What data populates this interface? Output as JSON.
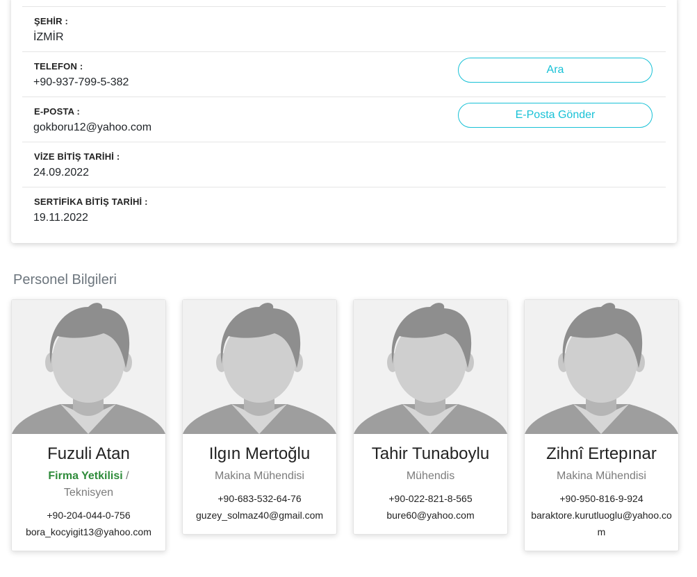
{
  "contact_info": {
    "rows": [
      {
        "label": "ŞEHİR :",
        "value": "İZMİR"
      },
      {
        "label": "TELEFON :",
        "value": "+90-937-799-5-382",
        "button": "Ara"
      },
      {
        "label": "E-POSTA :",
        "value": "gokboru12@yahoo.com",
        "button": "E-Posta Gönder"
      },
      {
        "label": "VİZE BİTİŞ TARİHİ :",
        "value": "24.09.2022"
      },
      {
        "label": "SERTİFİKA BİTİŞ TARİHİ :",
        "value": "19.11.2022"
      }
    ]
  },
  "personnel": {
    "title": "Personel Bilgileri",
    "people": [
      {
        "name": "Fuzuli Atan",
        "role_highlight": "Firma Yetkilisi",
        "role_separator": " /",
        "role": "Teknisyen",
        "phone": "+90-204-044-0-756",
        "email": "bora_kocyigit13@yahoo.com"
      },
      {
        "name": "Ilgın Mertoğlu",
        "role": "Makina Mühendisi",
        "phone": "+90-683-532-64-76",
        "email": "guzey_solmaz40@gmail.com"
      },
      {
        "name": "Tahir Tunaboylu",
        "role": "Mühendis",
        "phone": "+90-022-821-8-565",
        "email": "bure60@yahoo.com"
      },
      {
        "name": "Zihnî Ertepınar",
        "role": "Makina Mühendisi",
        "phone": "+90-950-816-9-924",
        "email": "baraktore.kurutluoglu@yahoo.com"
      }
    ]
  },
  "colors": {
    "accent": "#17c1d6",
    "highlight_role": "#2e8b3a",
    "muted_text": "#7b7b7b"
  },
  "icons": {
    "avatar": "person-silhouette-placeholder"
  }
}
